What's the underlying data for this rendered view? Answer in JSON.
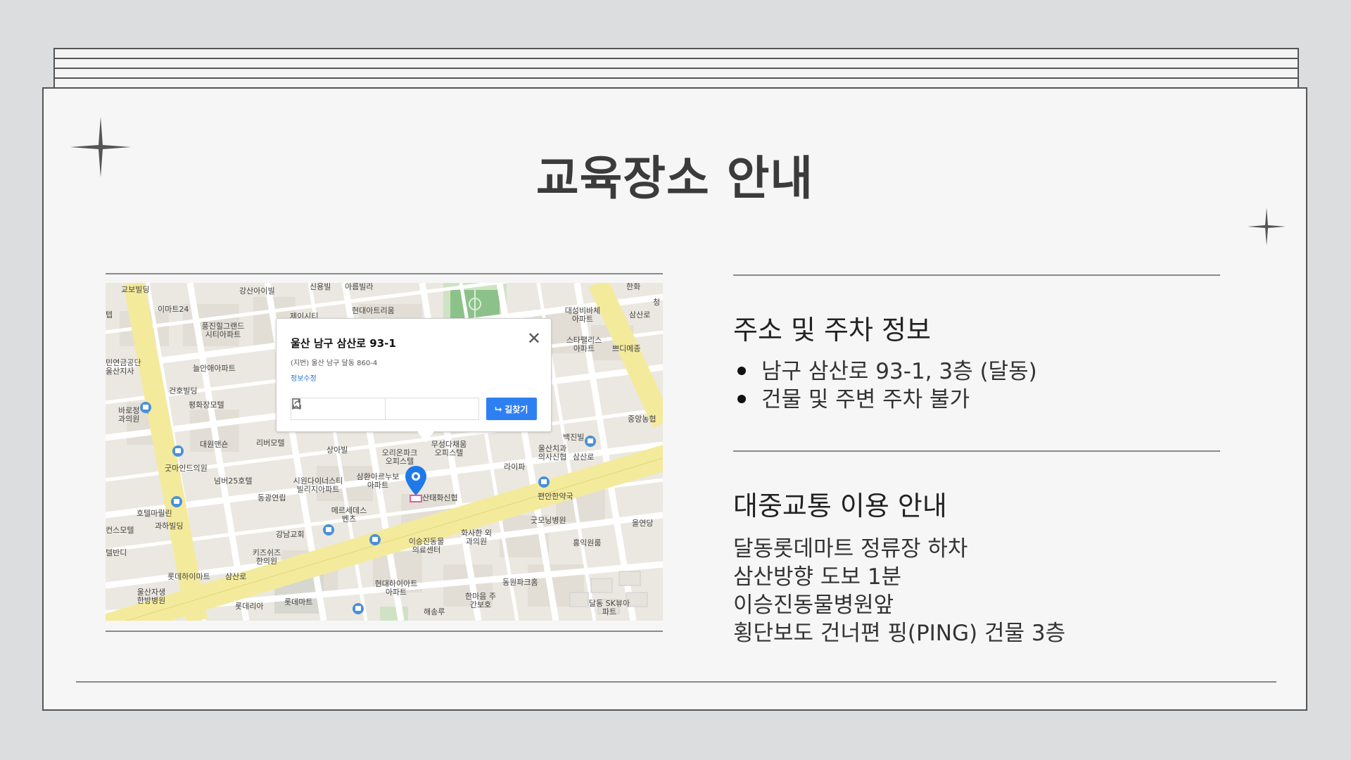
{
  "slide": {
    "title": "교육장소 안내"
  },
  "map": {
    "popup": {
      "address": "울산 남구 삼산로 93-1",
      "lot_address": "(지번) 울산 남구 달동 860-4",
      "edit_link": "정보수정",
      "route_button": "길찾기"
    },
    "labels": [
      "교보빌딩",
      "이마트24",
      "강산아이빌",
      "제이시티",
      "신용빌",
      "아름빌라",
      "현대아트리움",
      "풍진힐그랜드 시티아파트",
      "늘안애아파트",
      "민연금공단 울산지사",
      "건호빌딩",
      "평화장모텔",
      "바로정 외과의원",
      "대원맨숀",
      "리버모텔",
      "상아빌",
      "굿마인드의원",
      "넘버25호텔",
      "동광연립",
      "시원다이너스티 빌리지아파트",
      "삼환아르누보 아파트",
      "오리온파크 오피스텔",
      "무성다채움 오피스텔",
      "라이파",
      "울산치과 의사신협",
      "백진빌",
      "편안한약국",
      "산태화신협",
      "메르세데스 벤츠",
      "강남교회",
      "키즈쉬즈 한의원",
      "롯데하이마트",
      "울산자생 한방병원",
      "롯데리아",
      "롯데마트",
      "이승진동물 의료센터",
      "화사한 외과의원",
      "굿모닝병원",
      "홍익원룸",
      "현대하이아트 아파트",
      "한마음 주간보호",
      "동원파크홈",
      "해송루",
      "달동 SK뷰아파트",
      "호텔마릴린",
      "과하빌딩",
      "컨스모텔",
      "텔반디",
      "대성비바체 아파트",
      "스타팰리스 아파트",
      "쁘디메종",
      "중앙농협",
      "을연당",
      "삼산로",
      "한화",
      "텝",
      "청",
      "삼산로",
      "삼산로"
    ],
    "pin_color": "#1f7ae8",
    "road_color": "#f7eea2"
  },
  "info": {
    "address_section": {
      "title": "주소 및 주차 정보",
      "bullets": [
        "남구 삼산로 93-1, 3층 (달동)",
        "건물 및 주변 주차 불가"
      ]
    },
    "transit_section": {
      "title": "대중교통 이용 안내",
      "lines": [
        "달동롯데마트 정류장 하차",
        "삼산방향 도보 1분",
        "이승진동물병원앞",
        "횡단보도 건너편 핑(PING) 건물 3층"
      ]
    }
  },
  "colors": {
    "background": "#dcddde",
    "slide": "#f6f6f6",
    "accent_button": "#2e80f2"
  }
}
